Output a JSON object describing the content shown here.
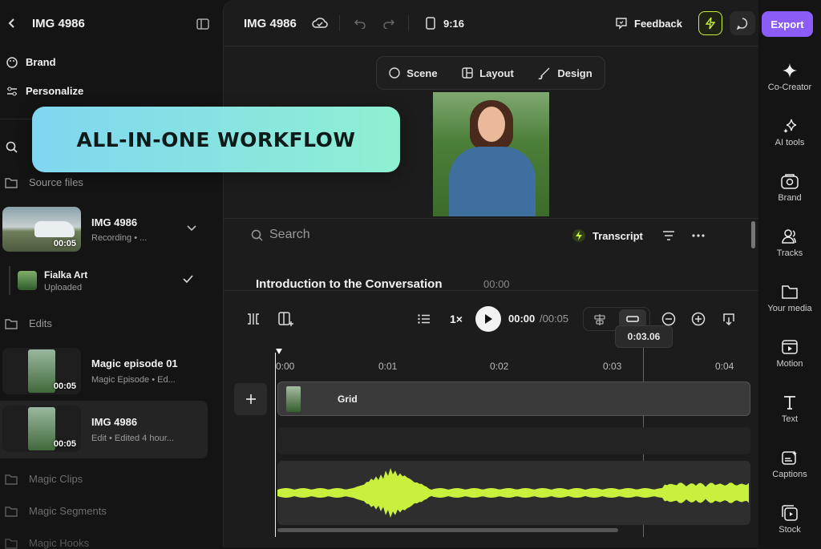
{
  "sidebar": {
    "project_title": "IMG 4986",
    "brand": "Brand",
    "personalize": "Personalize",
    "source_files": "Source files",
    "source_items": [
      {
        "title": "IMG 4986",
        "meta": "Recording • ...",
        "duration": "00:05"
      },
      {
        "title": "Fialka Art",
        "meta": "Uploaded"
      }
    ],
    "edits": "Edits",
    "edit_items": [
      {
        "title": "Magic episode 01",
        "meta": "Magic Episode • Ed...",
        "duration": "00:05"
      },
      {
        "title": "IMG 4986",
        "meta": "Edit • Edited 4 hour...",
        "duration": "00:05"
      }
    ],
    "magic_clips": "Magic Clips",
    "magic_segments": "Magic Segments",
    "magic_hooks": "Magic Hooks"
  },
  "banner": {
    "text": "ALL-IN-ONE WORKFLOW"
  },
  "topbar": {
    "title": "IMG 4986",
    "aspect": "9:16",
    "feedback": "Feedback",
    "export": "Export"
  },
  "scene_tabs": {
    "scene": "Scene",
    "layout": "Layout",
    "design": "Design"
  },
  "transcript": {
    "search_placeholder": "Search",
    "transcript_label": "Transcript",
    "section_title": "Introduction to the Conversation",
    "section_time": "00:00"
  },
  "playback": {
    "speed": "1×",
    "current": "00:00",
    "total": "/00:05",
    "tooltip": "0:03.06"
  },
  "timeline": {
    "ticks": [
      "0:00",
      "0:01",
      "0:02",
      "0:03",
      "0:04"
    ],
    "clip_label": "Grid"
  },
  "right_panel": [
    {
      "label": "Co-Creator",
      "icon": "sparkle-icon"
    },
    {
      "label": "AI tools",
      "icon": "sparkles-icon"
    },
    {
      "label": "Brand",
      "icon": "brand-icon"
    },
    {
      "label": "Tracks",
      "icon": "users-icon"
    },
    {
      "label": "Your media",
      "icon": "folder-icon"
    },
    {
      "label": "Motion",
      "icon": "motion-icon"
    },
    {
      "label": "Text",
      "icon": "text-icon"
    },
    {
      "label": "Captions",
      "icon": "captions-icon"
    },
    {
      "label": "Stock",
      "icon": "stock-icon"
    }
  ],
  "colors": {
    "accent": "#8b5cf6",
    "waveform": "#c8f03c",
    "banner_from": "#7fd6f0",
    "banner_to": "#8ef0d2"
  }
}
